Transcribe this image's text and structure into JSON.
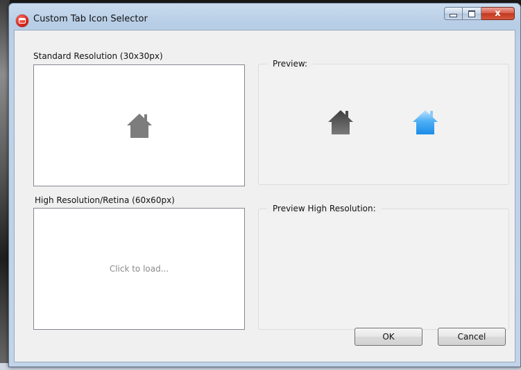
{
  "window": {
    "title": "Custom Tab Icon Selector",
    "close_glyph": "x"
  },
  "standard": {
    "label": "Standard Resolution (30x30px)",
    "icon": "house-icon"
  },
  "high_res": {
    "label": "High Resolution/Retina (60x60px)",
    "hint": "Click to load..."
  },
  "preview": {
    "label": "Preview:",
    "icons": [
      "house-icon-gray",
      "house-icon-blue"
    ]
  },
  "preview_high": {
    "label": "Preview High Resolution:"
  },
  "buttons": {
    "ok": "OK",
    "cancel": "Cancel"
  },
  "colors": {
    "icon_gray": "#7d7d7d",
    "icon_dark": "#555555",
    "icon_blue": "#2e9bf0"
  }
}
